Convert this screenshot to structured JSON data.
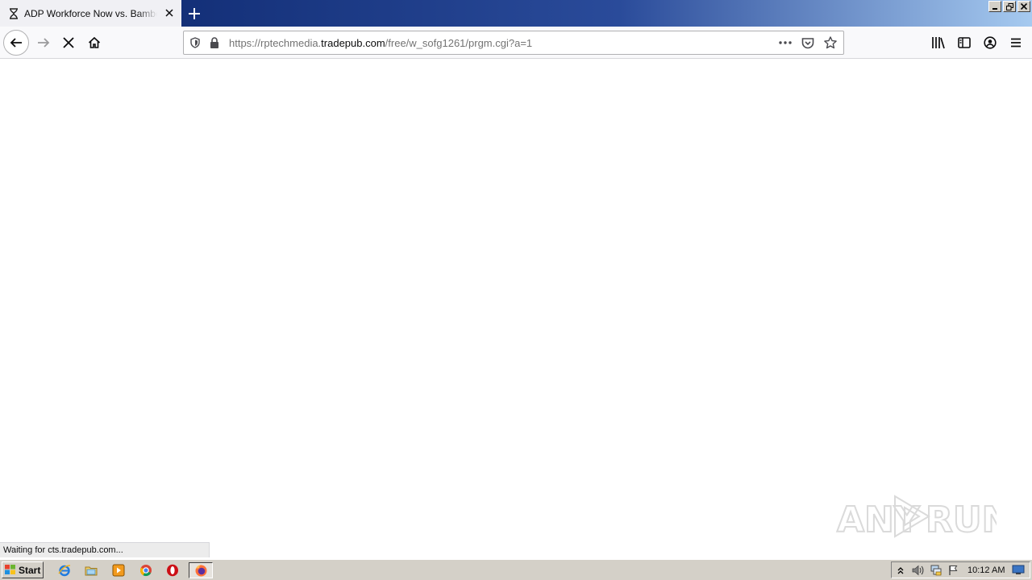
{
  "browser": {
    "tab": {
      "title": "ADP Workforce Now vs. BambooHR",
      "favicon": "hourglass-icon"
    },
    "url": {
      "prefix": "https://rptechmedia.",
      "domain": "tradepub.com",
      "suffix": "/free/w_sofg1261/prgm.cgi?a=1"
    },
    "status_text": "Waiting for cts.tradepub.com...",
    "watermark": "ANY RUN"
  },
  "taskbar": {
    "start_label": "Start",
    "clock": "10:12 AM",
    "quick_launch": [
      "internet-explorer-icon",
      "folder-icon",
      "media-player-icon",
      "chrome-icon",
      "opera-icon",
      "firefox-icon"
    ]
  },
  "colors": {
    "titlebar_dark": "#0a246a",
    "titlebar_light": "#a6caf0",
    "taskbar": "#d4d0c8",
    "toolbar": "#f9f9fb"
  }
}
